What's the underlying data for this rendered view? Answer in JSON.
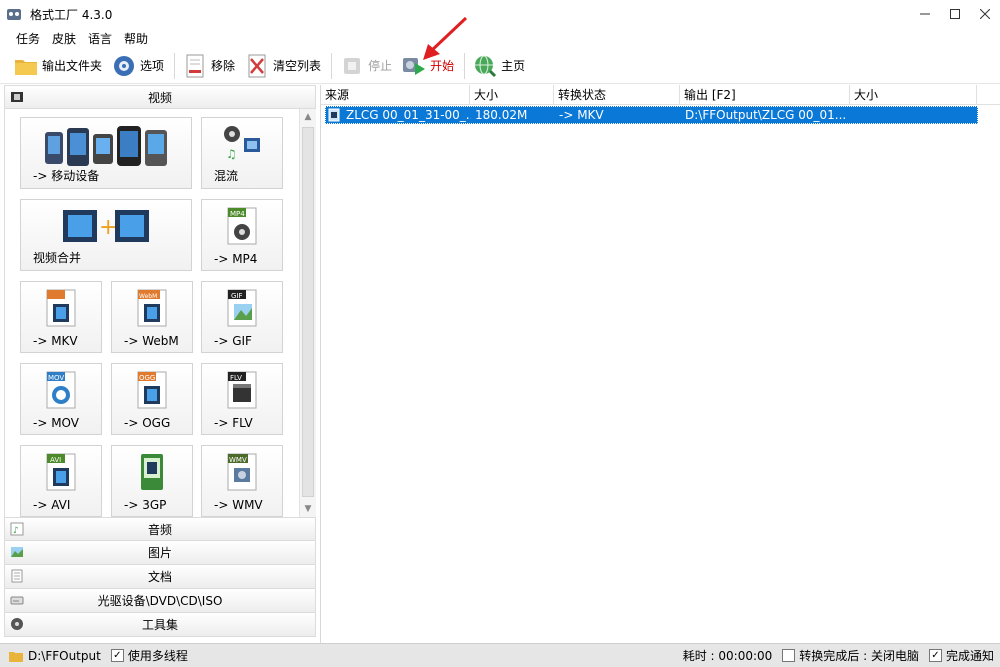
{
  "window": {
    "title": "格式工厂 4.3.0"
  },
  "menu": {
    "items": [
      "任务",
      "皮肤",
      "语言",
      "帮助"
    ]
  },
  "toolbar": {
    "output_folder": "输出文件夹",
    "options": "选项",
    "remove": "移除",
    "clear_list": "清空列表",
    "stop": "停止",
    "start": "开始",
    "home": "主页"
  },
  "left": {
    "video_label": "视频",
    "tiles": {
      "mobile": "-> 移动设备",
      "mux": "混流",
      "merge": "视频合并",
      "mp4": "-> MP4",
      "mkv": "-> MKV",
      "webm": "-> WebM",
      "gif": "-> GIF",
      "mov": "-> MOV",
      "ogg": "-> OGG",
      "flv": "-> FLV",
      "avi": "-> AVI",
      "3gp": "-> 3GP",
      "wmv": "-> WMV"
    },
    "badges": {
      "mp4": "MP4",
      "gif": "GIF",
      "mov": "MOV",
      "ogg": "OGG",
      "flv": "FLV",
      "avi": "AVI",
      "wmv": "WMV",
      "webm": "WebM"
    },
    "categories": {
      "audio": "音频",
      "image": "图片",
      "document": "文档",
      "disc": "光驱设备\\DVD\\CD\\ISO",
      "tools": "工具集"
    }
  },
  "table": {
    "headers": [
      "来源",
      "大小",
      "转换状态",
      "输出 [F2]",
      "大小"
    ],
    "row": {
      "source": "ZLCG 00_01_31-00_...",
      "size": "180.02M",
      "status": "-> MKV",
      "output": "D:\\FFOutput\\ZLCG 00_01...",
      "out_size": ""
    }
  },
  "status": {
    "output_path": "D:\\FFOutput",
    "multithread": "使用多线程",
    "elapsed": "耗时 : 00:00:00",
    "after_done": "转换完成后 : 关闭电脑",
    "notify": "完成通知"
  },
  "colors": {
    "selection": "#0a78d7",
    "accent_red": "#d00000",
    "badge_orange": "#e07a2f",
    "badge_blue": "#2f7fc8",
    "badge_black": "#222222",
    "badge_green": "#4c8a2a"
  }
}
